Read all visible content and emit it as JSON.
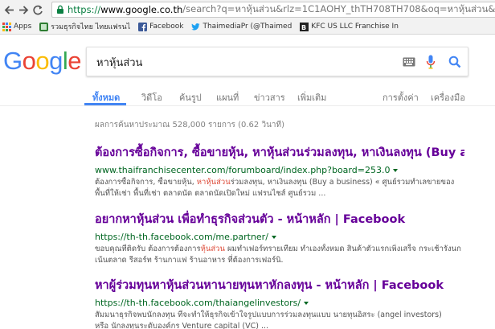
{
  "browser": {
    "url_scheme": "https://",
    "url_host": "www.google.co.th",
    "url_rest": "/search?q=หาหุ้นส่วน&rlz=1C1AOHY_thTH708TH708&oq=หาหุ้นส่วน&aqs",
    "bookmarks": [
      {
        "label": "Apps",
        "icon": "apps-grid-icon",
        "color": "#4285f4"
      },
      {
        "label": "รวมธุรกิจไทย ไทยแฟรนไ",
        "icon": "page-favicon",
        "color": "#2e7d32"
      },
      {
        "label": "Facebook",
        "icon": "facebook-icon",
        "color": "#3b5998"
      },
      {
        "label": "ThaimediaPr (@Thaimed",
        "icon": "twitter-icon",
        "color": "#1da1f2"
      },
      {
        "label": "KFC US LLC Franchise In",
        "icon": "page-favicon",
        "color": "#222222"
      }
    ]
  },
  "google": {
    "logo_letters": [
      {
        "char": "G",
        "color": "#4285f4"
      },
      {
        "char": "o",
        "color": "#ea4335"
      },
      {
        "char": "o",
        "color": "#fbbc05"
      },
      {
        "char": "g",
        "color": "#4285f4"
      },
      {
        "char": "l",
        "color": "#34a853"
      },
      {
        "char": "e",
        "color": "#ea4335"
      }
    ],
    "query": "หาหุ้นส่วน"
  },
  "tabs": {
    "all": "ทั้งหมด",
    "videos": "วิดีโอ",
    "images": "ค้นรูป",
    "maps": "แผนที่",
    "news": "ข่าวสาร",
    "more": "เพิ่มเติม",
    "settings": "การตั้งค่า",
    "tools": "เครื่องมือ"
  },
  "stats": "ผลการค้นหาประมาณ 528,000 รายการ  (0.62 วินาที)",
  "results": [
    {
      "title": "ต้องการซื้อกิจการ, ซื้อขายหุ้น, หาหุ้นส่วนร่วมลงทุน, หาเงินลงทุน (Buy a busin...",
      "url": "www.thaifranchisecenter.com/forumboard/index.php?board=253.0",
      "snippet_1_pre": "ต้องการซื้อกิจการ, ซื้อขายหุ้น, ",
      "snippet_1_hl": "หาหุ้นส่วน",
      "snippet_1_post": "ร่วมลงทุน, หาเงินลงทุน (Buy a business) « ศูนย์รวมทำเลขายของ",
      "snippet_2": "พื้นที่ให้เช่า พื้นที่เช่า ตลาดนัด ตลาดนัดเปิดใหม่ แฟรนไชส์ ศูนย์รวม ..."
    },
    {
      "title": "อยากหาหุ้นส่วน เพื่อทำธุรกิจส่วนตัว - หน้าหลัก | Facebook",
      "url": "https://th-th.facebook.com/me.partner/",
      "snippet_1_pre": "ขอบคุณที่ติดรับ ต้องการต้องการ",
      "snippet_1_hl": "หุ้นส่วน",
      "snippet_1_post": " ผมทำเฟอร์ทรายเทียม ทำเองทั้งหมด สินค้าตัวแรกเพิ่งเสร็จ กระเช้ารังนก",
      "snippet_2": "เน้นตลาด รีสอร์ท ร้านกาแฟ ร้านอาหาร ที่ต้องการเฟอร์นิ."
    },
    {
      "title": "หาผู้ร่วมทุนหาหุ้นส่วนหานายทุนหาหักลงทุน - หน้าหลัก | Facebook",
      "url": "https://th-th.facebook.com/thaiangelinvestors/",
      "snippet_1_pre": "สัมมนาธุรกิจพบนักลงทุน ที่จะทำให้ธุรกิจเข้าใจรูปแบบการร่วมลงทุนแบบ นายทุนอิสระ (angel investors)",
      "snippet_1_hl": "",
      "snippet_1_post": "",
      "snippet_2": "หรือ นักลงทุนระดับองค์กร Venture capital (VC) ..."
    }
  ]
}
